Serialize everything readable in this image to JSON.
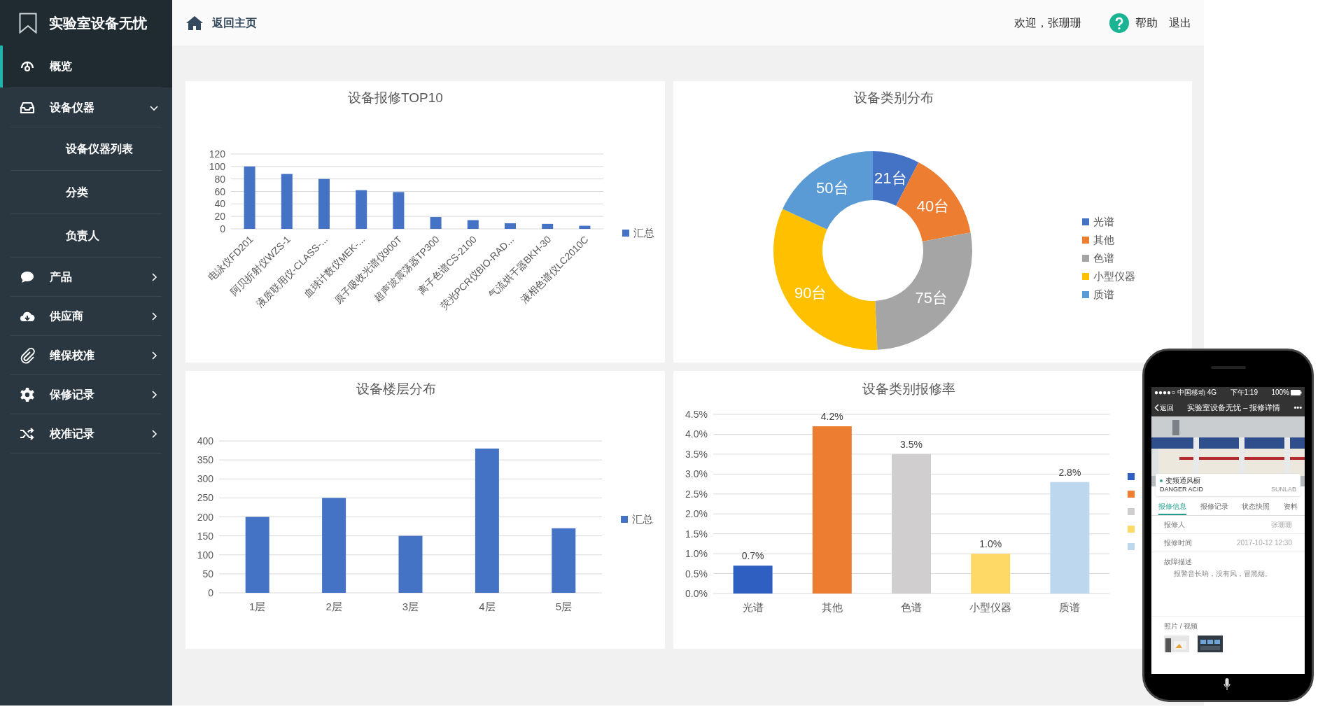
{
  "sidebar": {
    "brand": "实验室设备无忧",
    "items": [
      {
        "kind": "link",
        "label": "概览",
        "selected": true
      },
      {
        "kind": "group",
        "label": "设备仪器",
        "selected": false,
        "expanded": true,
        "children": [
          {
            "label": "设备仪器列表",
            "selected": false
          },
          {
            "label": "分类",
            "selected": false
          },
          {
            "label": "负责人",
            "selected": false
          }
        ]
      },
      {
        "kind": "group",
        "label": "产品",
        "selected": false,
        "expanded": false
      },
      {
        "kind": "group",
        "label": "供应商",
        "selected": false,
        "expanded": false
      },
      {
        "kind": "group",
        "label": "维保校准",
        "selected": false,
        "expanded": false
      },
      {
        "kind": "group",
        "label": "保修记录",
        "selected": false,
        "expanded": false
      },
      {
        "kind": "group",
        "label": "校准记录",
        "selected": false,
        "expanded": false
      }
    ]
  },
  "header": {
    "home_link": "返回主页",
    "welcome": "欢迎，张珊珊",
    "help": "帮助",
    "logout": "退出"
  },
  "charts": [
    {
      "chart_data": {
        "type": "bar",
        "title": "设备报修TOP10",
        "categories": [
          "电泳仪FD201",
          "阿贝折射仪WZS-1",
          "液质联用仪-CLASS-...",
          "血球计数仪MEK-...",
          "原子吸收光谱仪900T",
          "超声波震荡器TP300",
          "离子色谱CS-2100",
          "荧光PCR仪BIO-RAD...",
          "气流烘干器BKH-30",
          "液相色谱仪LC2010C"
        ],
        "series": [
          {
            "name": "汇总",
            "color": "#4472c4",
            "values": [
              100,
              88,
              80,
              62,
              59,
              19,
              14,
              9,
              8,
              5
            ]
          }
        ],
        "ylim": [
          0,
          120
        ],
        "yticks": [
          0,
          20,
          40,
          60,
          80,
          100,
          120
        ],
        "grid": true,
        "legend": "right"
      }
    },
    {
      "chart_data": {
        "type": "donut",
        "title": "设备类别分布",
        "categories": [
          "光谱",
          "其他",
          "色谱",
          "小型仪器",
          "质谱"
        ],
        "values": [
          21,
          40,
          75,
          90,
          50
        ],
        "colors": [
          "#4472c4",
          "#ed7d31",
          "#a5a5a5",
          "#ffc000",
          "#5b9bd5"
        ],
        "value_labels": [
          "21台",
          "40台",
          "75台",
          "90台",
          "50台"
        ],
        "legend": "right"
      }
    },
    {
      "chart_data": {
        "type": "bar",
        "title": "设备楼层分布",
        "categories": [
          "1层",
          "2层",
          "3层",
          "4层",
          "5层"
        ],
        "series": [
          {
            "name": "汇总",
            "color": "#4472c4",
            "values": [
              200,
              250,
              150,
              380,
              170
            ]
          }
        ],
        "ylim": [
          0,
          400
        ],
        "yticks": [
          0,
          50,
          100,
          150,
          200,
          250,
          300,
          350,
          400
        ],
        "grid": true,
        "legend": "right"
      }
    },
    {
      "chart_data": {
        "type": "bar",
        "title": "设备类别报修率",
        "categories": [
          "光谱",
          "其他",
          "色谱",
          "小型仪器",
          "质谱"
        ],
        "series": [
          {
            "color": "#2f5fc0",
            "values": [
              0.7,
              null,
              null,
              null,
              null
            ]
          },
          {
            "color": "#ed7d31",
            "values": [
              null,
              4.2,
              null,
              null,
              null
            ]
          },
          {
            "color": "#d0cece",
            "values": [
              null,
              null,
              3.5,
              null,
              null
            ]
          },
          {
            "color": "#ffd966",
            "values": [
              null,
              null,
              null,
              1.0,
              null
            ]
          },
          {
            "color": "#bdd7ee",
            "values": [
              null,
              null,
              null,
              null,
              2.8
            ]
          }
        ],
        "ylim": [
          0,
          4.5
        ],
        "yticks": [
          {
            "value": 0,
            "label": "0.0%"
          },
          {
            "value": 0.5,
            "label": "0.5%"
          },
          {
            "value": 1,
            "label": "1.0%"
          },
          {
            "value": 1.5,
            "label": "1.5%"
          },
          {
            "value": 2,
            "label": "2.0%"
          },
          {
            "value": 2.5,
            "label": "2.5%"
          },
          {
            "value": 3,
            "label": "3.0%"
          },
          {
            "value": 3.5,
            "label": "3.5%"
          },
          {
            "value": 4,
            "label": "4.0%"
          },
          {
            "value": 4.5,
            "label": "4.5%"
          }
        ],
        "value_labels": [
          "0.7%",
          "4.2%",
          "3.5%",
          "1.0%",
          "2.8%"
        ],
        "grid": true,
        "legend": "right"
      }
    }
  ],
  "phone": {
    "status": {
      "carrier": "●●●●○ 中国移动 4G",
      "time": "下午1:19",
      "battery": "100%"
    },
    "nav": {
      "back": "返回",
      "title": "实验室设备无忧 – 报修详情",
      "more": "•••"
    },
    "device_card": {
      "name": "变频通风橱",
      "model": "DANGER ACID",
      "brand": "SUNLAB"
    },
    "tabs": [
      {
        "label": "报修信息",
        "selected": true
      },
      {
        "label": "报修记录",
        "selected": false
      },
      {
        "label": "状态快照",
        "selected": false
      },
      {
        "label": "资料",
        "selected": false
      }
    ],
    "fields": [
      {
        "label": "报修人",
        "value": "张珊珊"
      },
      {
        "label": "报修时间",
        "value": "2017-10-12 12:30"
      }
    ],
    "fault": {
      "label": "故障描述",
      "text": "报警音长响，没有风，冒黑烟。"
    },
    "media_label": "照片 / 视频"
  }
}
